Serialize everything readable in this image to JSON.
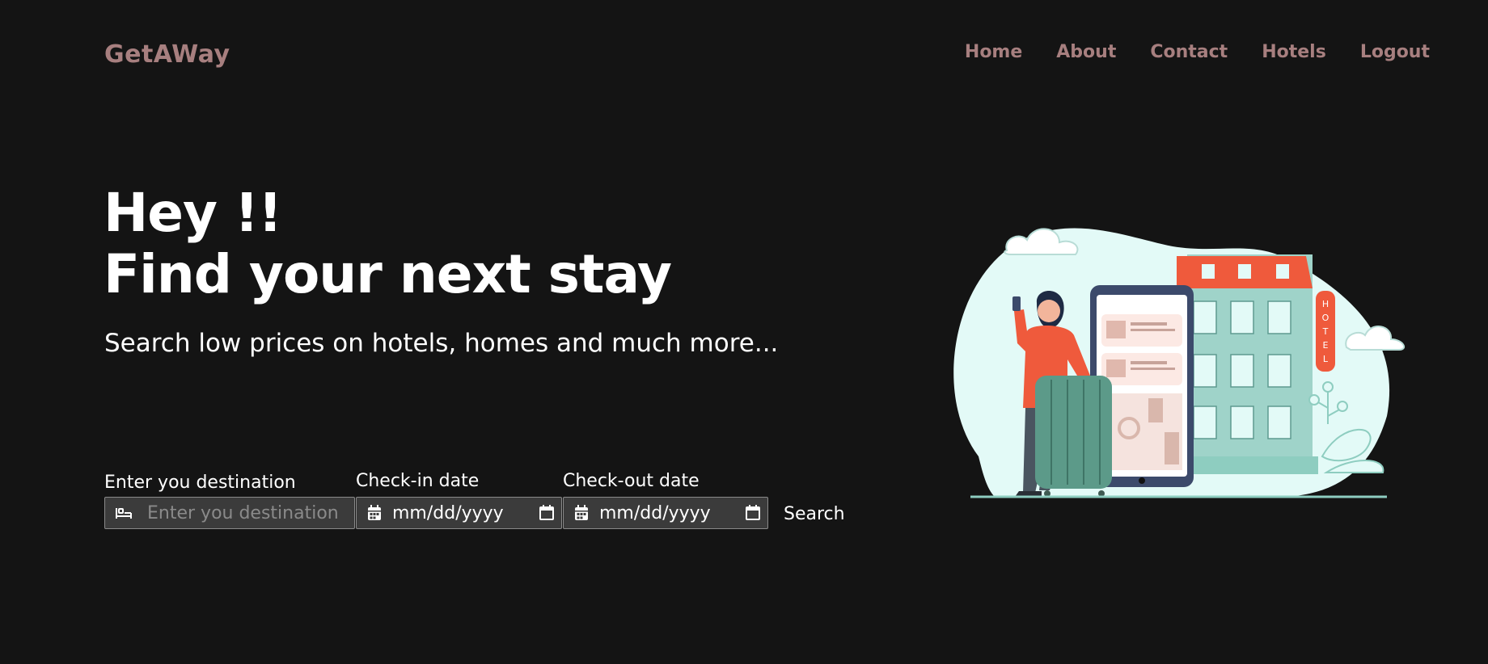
{
  "brand": "GetAWay",
  "nav": [
    "Home",
    "About",
    "Contact",
    "Hotels",
    "Logout"
  ],
  "hero": {
    "line1": "Hey !!",
    "line2": "Find your next stay",
    "subtitle": "Search low prices on hotels, homes and much more..."
  },
  "form": {
    "destination_label": "Enter you destination",
    "destination_placeholder": "Enter you destination",
    "checkin_label": "Check-in date",
    "checkin_value": "mm/dd/yyyy",
    "checkout_label": "Check-out date",
    "checkout_value": "mm/dd/yyyy",
    "search_label": "Search"
  },
  "illustration": {
    "sign_letters": [
      "H",
      "O",
      "T",
      "E",
      "L"
    ]
  },
  "colors": {
    "background": "#141414",
    "brand": "#a77f7f",
    "input_bg": "#3b3b3b",
    "accent_orange": "#ef5a3c",
    "teal": "#8ecdc0"
  }
}
